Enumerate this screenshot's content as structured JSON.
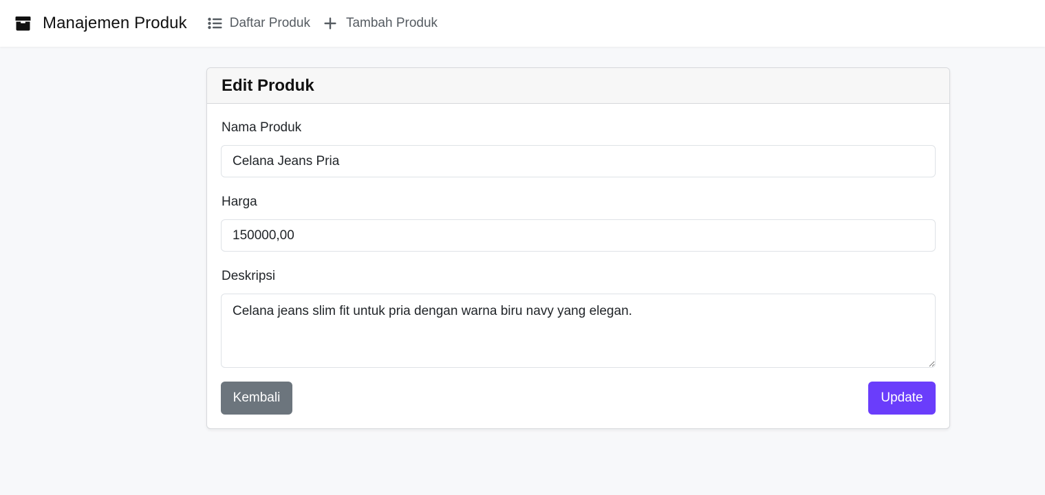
{
  "navbar": {
    "brand": "Manajemen Produk",
    "brand_icon": "box-icon",
    "links": [
      {
        "label": "Daftar Produk",
        "icon": "list-icon"
      },
      {
        "label": "Tambah Produk",
        "icon": "plus-icon"
      }
    ]
  },
  "card": {
    "title": "Edit Produk",
    "fields": {
      "nama": {
        "label": "Nama Produk",
        "value": "Celana Jeans Pria"
      },
      "harga": {
        "label": "Harga",
        "value": "150000,00"
      },
      "deskripsi": {
        "label": "Deskripsi",
        "value": "Celana jeans slim fit untuk pria dengan warna biru navy yang elegan."
      }
    },
    "buttons": {
      "back": "Kembali",
      "update": "Update"
    }
  },
  "colors": {
    "primary": "#6a3dfb",
    "secondary": "#6c757d",
    "background": "#f7f8fa"
  }
}
